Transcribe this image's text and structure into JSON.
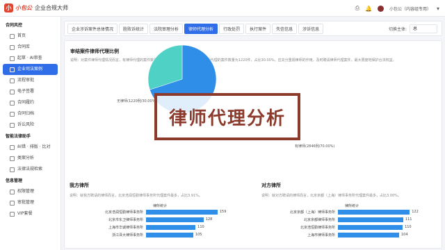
{
  "app": {
    "logo_mark": "小",
    "brand": "小包公",
    "title": "企业合规大师"
  },
  "topbar": {
    "user": "小包公（内容组专用）",
    "user_menu_icon": "chevron-down-icon"
  },
  "sidebar": {
    "groups": [
      {
        "title": "合同风控",
        "items": [
          {
            "label": "首页"
          },
          {
            "label": "合同库"
          },
          {
            "label": "起草 · AI审查"
          },
          {
            "label": "企业司法案例",
            "active": true
          },
          {
            "label": "流程审批"
          },
          {
            "label": "电子签署"
          },
          {
            "label": "合同履约"
          },
          {
            "label": "合同归档"
          },
          {
            "label": "诉讼风险"
          }
        ]
      },
      {
        "title": "智能法律助手",
        "items": [
          {
            "label": "纠错 · 排版 · 比对"
          },
          {
            "label": "类案分析"
          },
          {
            "label": "法律法规检索"
          }
        ]
      },
      {
        "title": "信息管理",
        "items": [
          {
            "label": "权限管理"
          },
          {
            "label": "审批管理"
          },
          {
            "label": "VIP套餐"
          }
        ]
      }
    ]
  },
  "tabs": {
    "items": [
      "企业涉诉案件总体情况",
      "胜败诉统计",
      "法院审理分析",
      "律师代理分析",
      "行政处罚",
      "执行案件",
      "失信信息",
      "涉诉信息"
    ],
    "active_index": 3,
    "switch_label": "切换主体:",
    "switch_value": "总"
  },
  "panel": {
    "title": "审结案件律师代理比例",
    "desc": "说明：对案件律师代理情况而言，有律师代理的案件数量为2846件，占比70.00%；无律师代理的案件数量为1220件，占比30.00%。应充分重视律师的作用，及时聘请律师代理案件，最大限度地保护合法权益。"
  },
  "chart_data": {
    "type": "pie",
    "slices": [
      {
        "name": "有律师",
        "label": "有律师(2846例/70.00%)",
        "value": 2846,
        "percent": 70.0,
        "color": "#2f8ee8"
      },
      {
        "name": "无律师",
        "label": "无律师(1220例/30.00%)",
        "value": 1220,
        "percent": 30.0,
        "color": "#4fd1c5"
      }
    ]
  },
  "overlay": {
    "text": "律师代理分析"
  },
  "our_lawyers": {
    "title": "我方律所",
    "desc": "说明：就我方聘请的律师而言，北京浩润恒勤律师事务所代理案件最多，占比3.91%。",
    "stat_title": "律所统计",
    "rows": [
      {
        "name": "北京浩润恒勤律师事务所",
        "value": 159
      },
      {
        "name": "北京市东卫律师事务所",
        "value": 128
      },
      {
        "name": "上海市华诚律师事务所",
        "value": 110
      },
      {
        "name": "浙江泽大律师事务所",
        "value": 105
      }
    ],
    "max": 170
  },
  "their_lawyers": {
    "title": "对方律所",
    "desc": "说明：就对方聘请的律师而言，北京京都（上海）律师事务所代理案件最多，占比3.00%。",
    "stat_title": "律所统计",
    "rows": [
      {
        "name": "北京京都（上海）律师事务所",
        "value": 122
      },
      {
        "name": "北京京都律师事务所",
        "value": 111
      },
      {
        "name": "北京浩恒勤律师事务所",
        "value": 110
      },
      {
        "name": "上海市律师事务所",
        "value": 104
      }
    ],
    "max": 130
  }
}
